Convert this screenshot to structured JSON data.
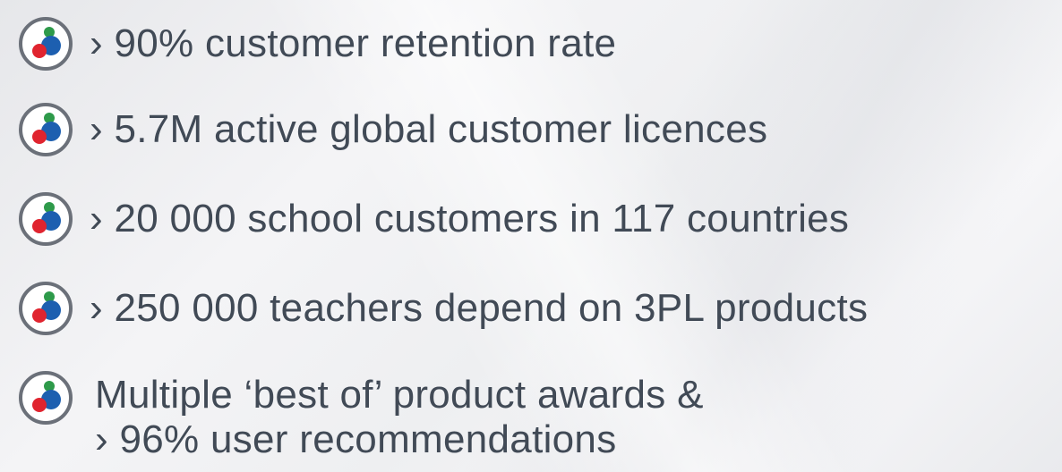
{
  "stats": [
    {
      "icon": "colored-dots-badge-icon",
      "text": "› 90% customer retention rate"
    },
    {
      "icon": "colored-dots-badge-icon",
      "text": "› 5.7M active global customer licences"
    },
    {
      "icon": "colored-dots-badge-icon",
      "text": "› 20 000 school customers in 117 countries"
    },
    {
      "icon": "colored-dots-badge-icon",
      "text": "› 250 000 teachers depend on 3PL products"
    },
    {
      "icon": "colored-dots-badge-icon",
      "lines": [
        "Multiple ‘best of’ product awards &",
        "› 96%  user recommendations"
      ]
    }
  ],
  "colors": {
    "text": "#414a56",
    "badge_ring": "#6b7079",
    "dot_red": "#e0242f",
    "dot_blue": "#1d5fb0",
    "dot_green": "#2e9a4a"
  }
}
